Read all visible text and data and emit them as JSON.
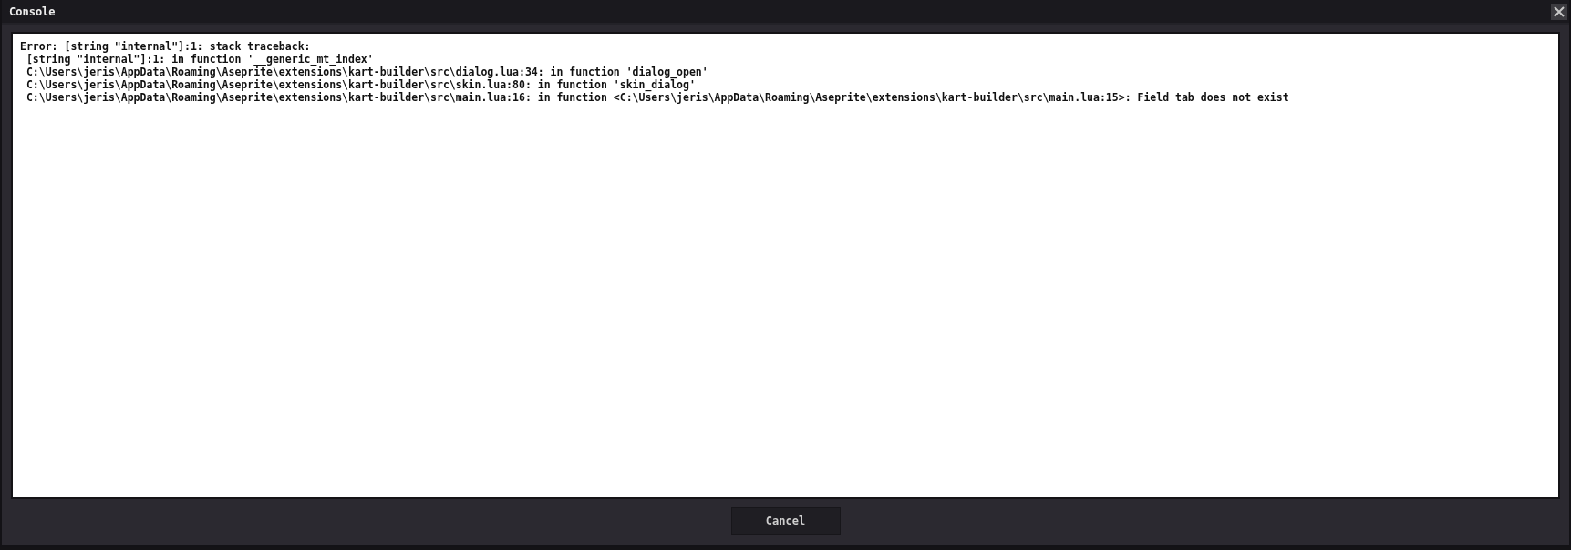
{
  "window": {
    "title": "Console"
  },
  "console": {
    "lines": [
      "Error: [string \"internal\"]:1: stack traceback:",
      " [string \"internal\"]:1: in function '__generic_mt_index'",
      " C:\\Users\\jeris\\AppData\\Roaming\\Aseprite\\extensions\\kart-builder\\src\\dialog.lua:34: in function 'dialog_open'",
      " C:\\Users\\jeris\\AppData\\Roaming\\Aseprite\\extensions\\kart-builder\\src\\skin.lua:80: in function 'skin_dialog'",
      " C:\\Users\\jeris\\AppData\\Roaming\\Aseprite\\extensions\\kart-builder\\src\\main.lua:16: in function <C:\\Users\\jeris\\AppData\\Roaming\\Aseprite\\extensions\\kart-builder\\src\\main.lua:15>: Field tab does not exist"
    ]
  },
  "buttons": [
    "Cancel"
  ]
}
